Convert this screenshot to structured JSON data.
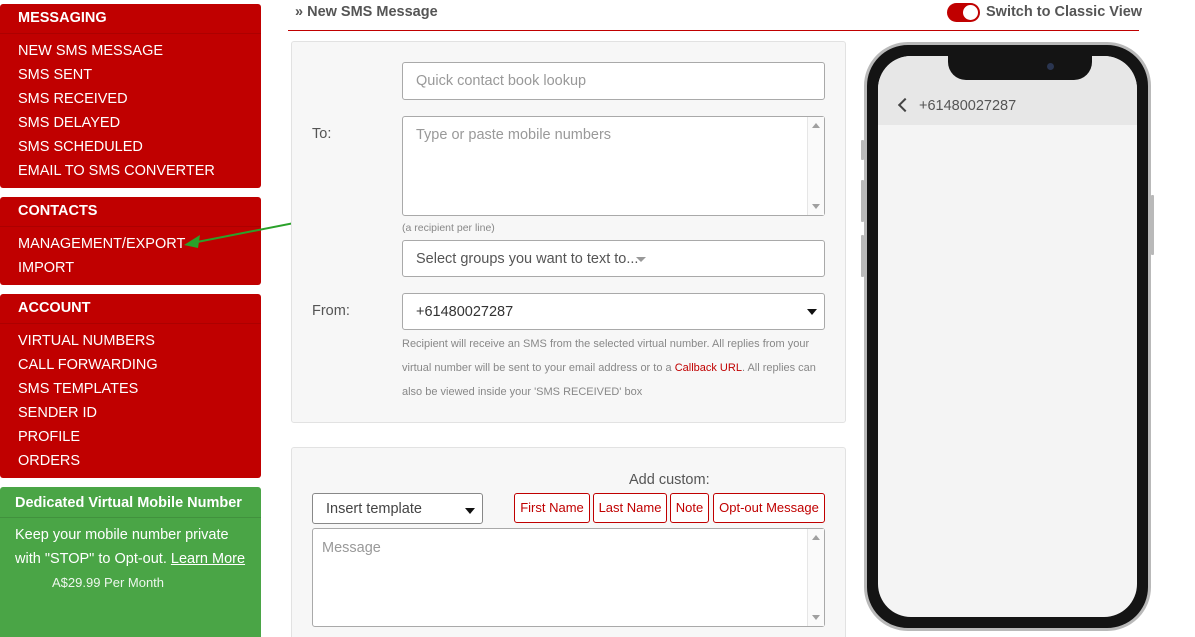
{
  "sidebar": {
    "messaging": {
      "header": "MESSAGING",
      "items": [
        "NEW SMS MESSAGE",
        "SMS SENT",
        "SMS RECEIVED",
        "SMS DELAYED",
        "SMS SCHEDULED",
        "EMAIL TO SMS CONVERTER"
      ]
    },
    "contacts": {
      "header": "CONTACTS",
      "items": [
        "MANAGEMENT/EXPORT",
        "IMPORT"
      ]
    },
    "account": {
      "header": "ACCOUNT",
      "items": [
        "VIRTUAL NUMBERS",
        "CALL FORWARDING",
        "SMS TEMPLATES",
        "SENDER ID",
        "PROFILE",
        "ORDERS"
      ]
    },
    "promo": {
      "title": "Dedicated Virtual Mobile Number",
      "body": "Keep your mobile number private with \"STOP\" to Opt-out.",
      "link": "Learn More",
      "price": "A$29.99 Per Month"
    }
  },
  "header": {
    "title": "» New SMS Message",
    "toggle_label": "Switch to Classic View"
  },
  "form": {
    "to_label": "To:",
    "contact_lookup_placeholder": "Quick contact book lookup",
    "numbers_placeholder": "Type or paste mobile numbers",
    "recipient_hint": "(a recipient per line)",
    "groups_placeholder": "Select groups you want to text to...",
    "from_label": "From:",
    "from_value": "+61480027287",
    "help_text_1": "Recipient will receive an SMS from the selected virtual number. All replies from your virtual number will be sent to your email address or to a",
    "help_link": "Callback URL",
    "help_text_2": ". All replies can also be viewed inside your 'SMS RECEIVED' box"
  },
  "composer": {
    "add_custom_label": "Add custom:",
    "template_placeholder": "Insert template",
    "tags": [
      "First Name",
      "Last Name",
      "Note",
      "Opt-out Message"
    ],
    "message_placeholder": "Message"
  },
  "phone": {
    "contact_number": "+61480027287"
  },
  "colors": {
    "brand_red": "#c00000",
    "promo_green": "#4aa546",
    "arrow_green": "#2aa12a"
  }
}
